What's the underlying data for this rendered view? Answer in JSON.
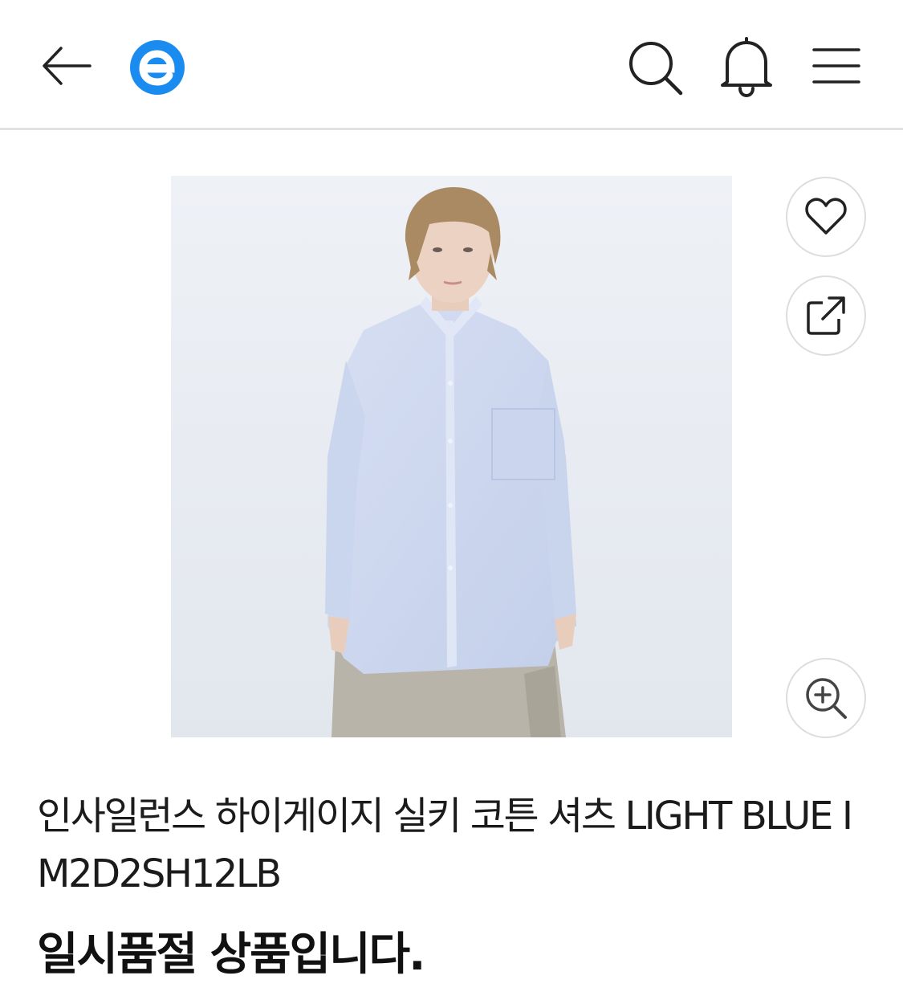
{
  "header": {
    "back": "back-arrow-icon",
    "logo": "brand-logo-e",
    "search": "search-icon",
    "notifications": "bell-icon",
    "menu": "hamburger-menu-icon"
  },
  "product": {
    "title": "인사일런스 하이게이지 실키 코튼 셔츠 LIGHT BLUE IM2D2SH12LB",
    "status": "일시품절 상품입니다.",
    "actions": [
      "heart-icon",
      "share-icon",
      "zoom-in-icon"
    ]
  },
  "colors": {
    "brand": "#1a8cf0",
    "divider": "#e2e2e2",
    "shirt": "#cfdaf0"
  }
}
